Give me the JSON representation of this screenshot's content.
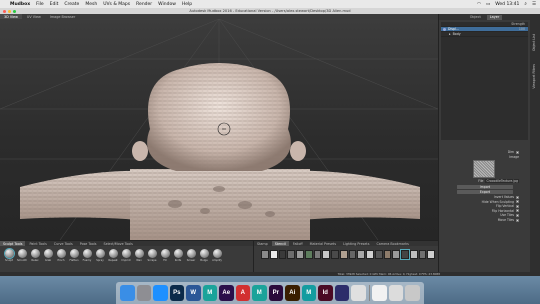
{
  "menubar": {
    "apple_icon": "apple-icon",
    "app_name": "Mudbox",
    "items": [
      "File",
      "Edit",
      "Create",
      "Mesh",
      "UVs & Maps",
      "Render",
      "Window",
      "Help"
    ],
    "clock": "Wed 13:41"
  },
  "window": {
    "title": "Autodesk Mudbox 2016 - Educational Version - /Users/alex.stewart/Desktop/3D Alien.mud",
    "traffic_light_colors": [
      "#ff5f57",
      "#febc2e",
      "#28c840"
    ]
  },
  "view_tabs": [
    "3D View",
    "UV View",
    "Image Browser"
  ],
  "right_panel": {
    "tabs": [
      "Object",
      "Layer"
    ],
    "layer_header": [
      "Strength"
    ],
    "layers": [
      {
        "name": "Displ...",
        "value": "100"
      },
      {
        "name": "Body",
        "value": ""
      }
    ],
    "properties": {
      "dim_label": "Dim",
      "image_label": "Image",
      "file_label": "File",
      "file_value": "CrocodileTexture.jpg",
      "import_label": "Import",
      "export_label": "Export",
      "invert_values": "Invert Values",
      "hide_when_sculpting": "Hide When Sculpting",
      "flip_vertical": "Flip Vertical",
      "flip_horizontal": "Flip Horizontal",
      "use_tiles": "Use Tiles",
      "move_tiles": "Move Tiles"
    },
    "side_tabs": [
      "Object List",
      "Viewport Filters"
    ]
  },
  "bottom_left": {
    "tabs": [
      "Sculpt Tools",
      "Paint Tools",
      "Curve Tools",
      "Pose Tools",
      "Select/Move Tools"
    ],
    "tools": [
      "Sculpt",
      "Smooth",
      "Relax",
      "Grab",
      "Pinch",
      "Flatten",
      "Foamy",
      "Spray",
      "Repeat",
      "Imprint",
      "Wax",
      "Scrape",
      "Fill",
      "Knife",
      "Smear",
      "Bulge",
      "Amplify"
    ]
  },
  "bottom_right": {
    "tabs": [
      "Stamp",
      "Stencil",
      "Falloff",
      "Material Presets",
      "Lighting Presets",
      "Camera Bookmarks"
    ],
    "stamp_colors": [
      "#8a8a8a",
      "#e8e8e8",
      "#3a3a3a",
      "#6d6d6d",
      "#9c9c9c",
      "#5d7d5d",
      "#7a7a7a",
      "#c8c8c8",
      "#4a4a4a",
      "#b0a090",
      "#666666",
      "#a8a8a8",
      "#d0d0d0",
      "#555555",
      "#8d7b6a",
      "#999999",
      "#444444",
      "#bdbdbd",
      "#707070",
      "#cfcfcf"
    ]
  },
  "status": {
    "text": "Total: 33928  Selected: 0  GPU Mem: 96  Active: 0, Highest: 0  FPS: 43.8088"
  },
  "dock": {
    "apps": [
      {
        "icon": "finder-icon",
        "label": "",
        "color": "#3a8ee6"
      },
      {
        "icon": "launchpad-icon",
        "label": "",
        "color": "#8e8e93"
      },
      {
        "icon": "safari-icon",
        "label": "",
        "color": "#1e90ff"
      },
      {
        "icon": "photoshop-icon",
        "label": "Ps",
        "color": "#0b2a4a"
      },
      {
        "icon": "word-icon",
        "label": "W",
        "color": "#2b5797"
      },
      {
        "icon": "mudbox-icon",
        "label": "M",
        "color": "#1aa39a"
      },
      {
        "icon": "after-effects-icon",
        "label": "Ae",
        "color": "#2a0f4a"
      },
      {
        "icon": "autodesk-app-icon",
        "label": "A",
        "color": "#d23030"
      },
      {
        "icon": "mudbox-icon-2",
        "label": "M",
        "color": "#1aa39a"
      },
      {
        "icon": "premiere-icon",
        "label": "Pr",
        "color": "#2a0a3a"
      },
      {
        "icon": "illustrator-icon",
        "label": "Ai",
        "color": "#3a1e00"
      },
      {
        "icon": "maya-icon",
        "label": "M",
        "color": "#139ca0"
      },
      {
        "icon": "indesign-icon",
        "label": "Id",
        "color": "#4a0a24"
      },
      {
        "icon": "quicktime-icon",
        "label": "",
        "color": "#2c2c6a"
      },
      {
        "icon": "preview-icon",
        "label": "",
        "color": "#e0e0e0"
      },
      {
        "icon": "calendar-icon",
        "label": "",
        "color": "#f2f2f2"
      },
      {
        "icon": "documents-icon",
        "label": "",
        "color": "#dcdcdc"
      },
      {
        "icon": "trash-icon",
        "label": "",
        "color": "#c8c8c8"
      }
    ]
  }
}
